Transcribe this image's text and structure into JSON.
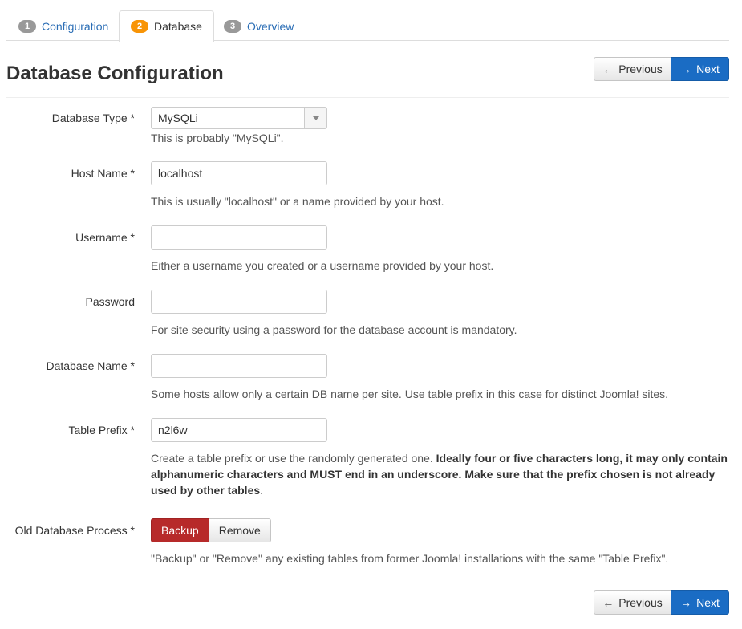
{
  "tabs": [
    {
      "num": "1",
      "label": "Configuration"
    },
    {
      "num": "2",
      "label": "Database"
    },
    {
      "num": "3",
      "label": "Overview"
    }
  ],
  "header": {
    "title": "Database Configuration",
    "previous_label": "Previous",
    "next_label": "Next"
  },
  "form": {
    "db_type": {
      "label": "Database Type *",
      "value": "MySQLi",
      "help": "This is probably \"MySQLi\"."
    },
    "host": {
      "label": "Host Name *",
      "value": "localhost",
      "help": "This is usually \"localhost\" or a name provided by your host."
    },
    "username": {
      "label": "Username *",
      "value": "",
      "help": "Either a username you created or a username provided by your host."
    },
    "password": {
      "label": "Password",
      "value": "",
      "help": "For site security using a password for the database account is mandatory."
    },
    "db_name": {
      "label": "Database Name *",
      "value": "",
      "help": "Some hosts allow only a certain DB name per site. Use table prefix in this case for distinct Joomla! sites."
    },
    "prefix": {
      "label": "Table Prefix *",
      "value": "n2l6w_",
      "help_plain": "Create a table prefix or use the randomly generated one. ",
      "help_bold": "Ideally four or five characters long, it may only contain alphanumeric characters and MUST end in an underscore. Make sure that the prefix chosen is not already used by other tables",
      "help_end": "."
    },
    "old_db": {
      "label": "Old Database Process *",
      "backup_label": "Backup",
      "remove_label": "Remove",
      "help": "\"Backup\" or \"Remove\" any existing tables from former Joomla! installations with the same \"Table Prefix\"."
    }
  },
  "footer": {
    "previous_label": "Previous",
    "next_label": "Next"
  },
  "colors": {
    "link": "#2a6db5",
    "primary": "#1a6cc4",
    "danger": "#b72a2a",
    "badge_active": "#f89406",
    "badge": "#999999"
  }
}
